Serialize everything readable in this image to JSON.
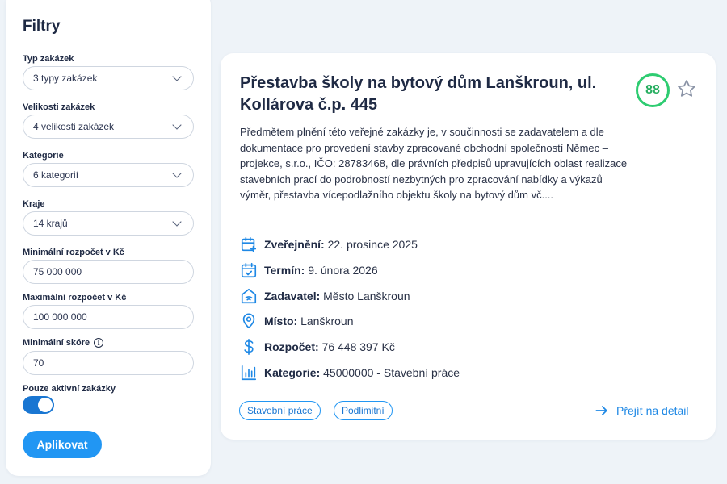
{
  "filters": {
    "title": "Filtry",
    "type": {
      "label": "Typ zakázek",
      "value": "3 typy zakázek"
    },
    "size": {
      "label": "Velikosti zakázek",
      "value": "4 velikosti zakázek"
    },
    "category": {
      "label": "Kategorie",
      "value": "6 kategorií"
    },
    "region": {
      "label": "Kraje",
      "value": "14 krajů"
    },
    "min_budget": {
      "label": "Minimální rozpočet v Kč",
      "value": "75 000 000"
    },
    "max_budget": {
      "label": "Maximální rozpočet v Kč",
      "value": "100 000 000"
    },
    "min_score": {
      "label": "Minimální skóre",
      "value": "70"
    },
    "active_only": {
      "label": "Pouze aktivní zakázky",
      "on": true
    },
    "apply_label": "Aplikovat"
  },
  "tender": {
    "title": "Přestavba školy na bytový dům Lanškroun, ul. Kollárova č.p. 445",
    "score": "88",
    "description": "Předmětem plnění této veřejné zakázky je, v součinnosti se zadavatelem a dle dokumentace pro provedení stavby zpracované obchodní společností Němec – projekce, s.r.o., IČO: 28783468, dle právních předpisů upravujících oblast realizace stavebních prací do podrobností nezbytných pro zpracování nabídky a výkazů výměr, přestavba vícepodlažního objektu školy na bytový dům vč....",
    "published": {
      "label": "Zveřejnění:",
      "value": "22. prosince 2025"
    },
    "deadline": {
      "label": "Termín:",
      "value": "9. února 2026"
    },
    "contracting": {
      "label": "Zadavatel:",
      "value": "Město Lanškroun"
    },
    "place": {
      "label": "Místo:",
      "value": "Lanškroun"
    },
    "budget": {
      "label": "Rozpočet:",
      "value": "76 448 397 Kč"
    },
    "category": {
      "label": "Kategorie:",
      "value": "45000000 - Stavební práce"
    },
    "tags": [
      "Stavební práce",
      "Podlimitní"
    ],
    "detail_label": "Přejít na detail"
  },
  "colors": {
    "accent": "#2196f3",
    "score_green": "#2ecc71",
    "text": "#1f2a44"
  }
}
